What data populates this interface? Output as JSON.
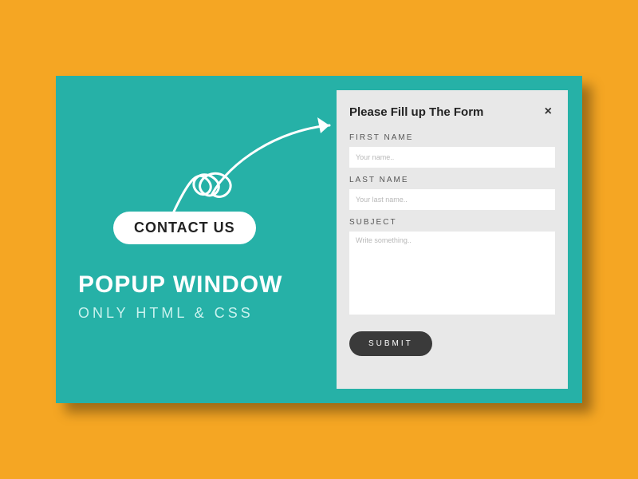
{
  "left": {
    "contact_label": "CONTACT US",
    "title": "POPUP WINDOW",
    "subtitle": "ONLY HTML & CSS"
  },
  "form": {
    "heading": "Please Fill up The Form",
    "close_symbol": "×",
    "fields": {
      "first_name": {
        "label": "FIRST NAME",
        "placeholder": "Your name.."
      },
      "last_name": {
        "label": "LAST NAME",
        "placeholder": "Your last name.."
      },
      "subject": {
        "label": "SUBJECT",
        "placeholder": "Write something.."
      }
    },
    "submit_label": "SUBMIT"
  },
  "colors": {
    "page_bg": "#f5a623",
    "panel_bg": "#26b1a7",
    "form_bg": "#e8e8e8",
    "submit_bg": "#3a3a3a"
  }
}
